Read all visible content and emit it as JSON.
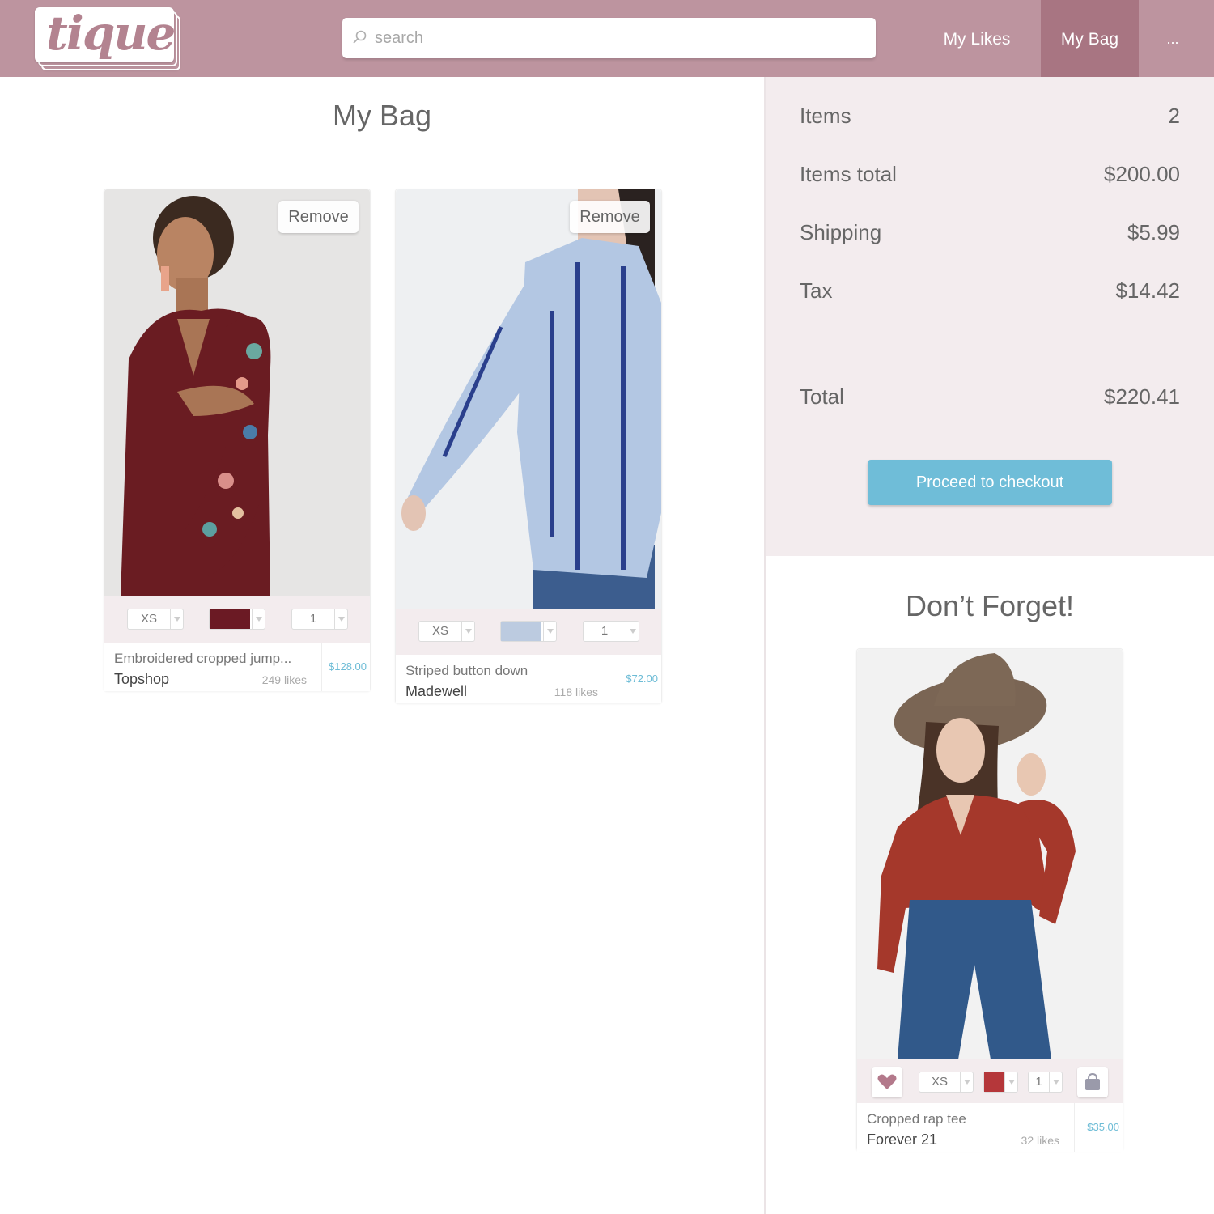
{
  "header": {
    "logo": "tique",
    "search_placeholder": "search",
    "nav": {
      "likes": "My Likes",
      "bag": "My Bag",
      "more": "..."
    },
    "colors": {
      "bar": "#bd949f",
      "active": "#a87582"
    }
  },
  "bag": {
    "title": "My Bag",
    "items": [
      {
        "remove_label": "Remove",
        "size": "XS",
        "color_swatch": "#6b1a24",
        "quantity": "1",
        "name": "Embroidered cropped jump...",
        "brand": "Topshop",
        "likes": "249 likes",
        "price": "$128.00"
      },
      {
        "remove_label": "Remove",
        "size": "XS",
        "color_swatch": "#bccbe0",
        "quantity": "1",
        "name": "Striped button down",
        "brand": "Madewell",
        "likes": "118 likes",
        "price": "$72.00"
      }
    ]
  },
  "summary": {
    "items_label": "Items",
    "items_value": "2",
    "items_total_label": "Items total",
    "items_total_value": "$200.00",
    "shipping_label": "Shipping",
    "shipping_value": "$5.99",
    "tax_label": "Tax",
    "tax_value": "$14.42",
    "total_label": "Total",
    "total_value": "$220.41",
    "checkout_label": "Proceed to checkout",
    "checkout_color": "#6fbdd8"
  },
  "reminder": {
    "title": "Don’t Forget!",
    "item": {
      "size": "XS",
      "color_swatch": "#b5373a",
      "quantity": "1",
      "name": "Cropped rap tee",
      "brand": "Forever 21",
      "likes": "32 likes",
      "price": "$35.00",
      "like_icon": "heart-icon",
      "bag_icon": "shopping-bag-icon"
    }
  }
}
